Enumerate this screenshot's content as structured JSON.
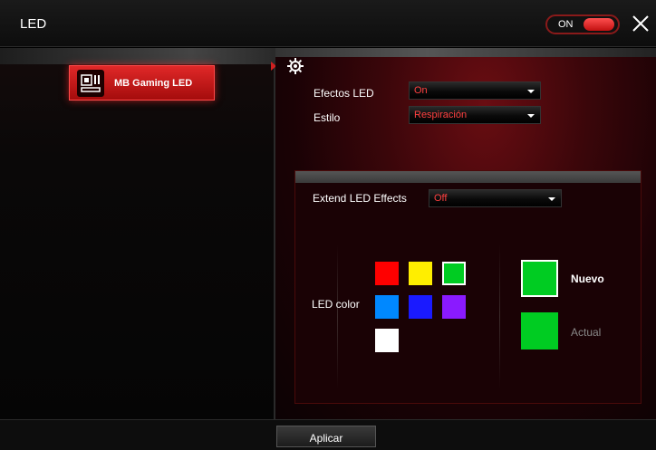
{
  "window": {
    "title": "LED",
    "toggle_label": "ON"
  },
  "sidebar": {
    "items": [
      {
        "label": "MB Gaming LED",
        "icon": "motherboard-icon",
        "active": true
      }
    ]
  },
  "settings": {
    "effects_label": "Efectos LED",
    "effects_value": "On",
    "style_label": "Estilo",
    "style_value": "Respiración"
  },
  "extend": {
    "label": "Extend LED Effects",
    "value": "Off"
  },
  "led_color": {
    "label": "LED color",
    "swatches": [
      "#ff0000",
      "#ffee00",
      "#00cc22",
      "#0088ff",
      "#1a1aff",
      "#8a1aff",
      "#ffffff"
    ],
    "selected_index": 2,
    "new_label": "Nuevo",
    "new_color": "#00cc22",
    "current_label": "Actual",
    "current_color": "#00cc22"
  },
  "footer": {
    "apply_label": "Aplicar"
  },
  "colors": {
    "accent": "#d02020",
    "dropdown_text": "#ff4040"
  }
}
